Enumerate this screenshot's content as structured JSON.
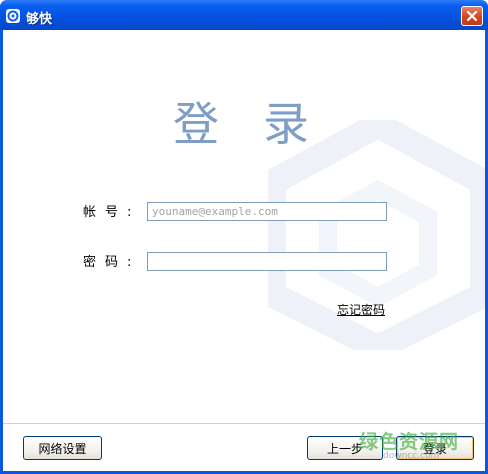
{
  "window": {
    "title": "够快",
    "close_glyph": "close-x-icon"
  },
  "login": {
    "heading": "登录",
    "account_label": "帐号:",
    "account_placeholder": "youname@example.com",
    "account_value": "",
    "password_label": "密码:",
    "password_value": "",
    "forgot_link": "忘记密码"
  },
  "footer": {
    "network_settings": "网络设置",
    "back": "上一步",
    "login": "登录"
  },
  "watermark": {
    "site_name": "绿色资源网",
    "site_url": "downcc.com"
  },
  "colors": {
    "titlebar": "#0551e0",
    "heading": "#7f9ec6",
    "input_border": "#7f9db9",
    "close_button": "#d2481f"
  }
}
